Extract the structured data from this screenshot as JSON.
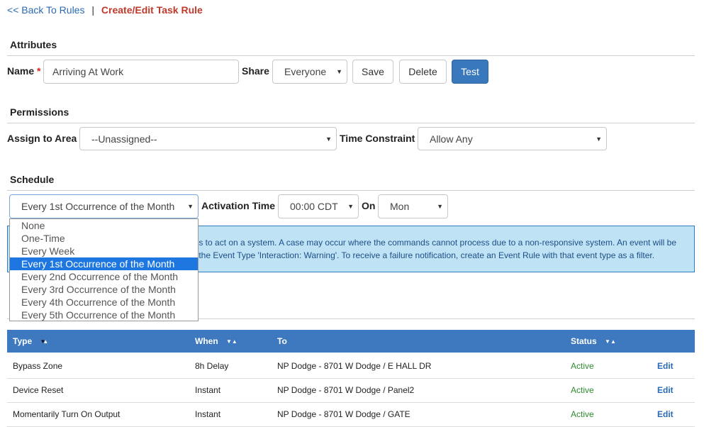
{
  "breadcrumb": {
    "back": "<< Back To Rules",
    "separator": "|",
    "current": "Create/Edit Task Rule"
  },
  "attributes": {
    "title": "Attributes",
    "name_label": "Name",
    "required_mark": "*",
    "name_value": "Arriving At Work",
    "share_label": "Share",
    "share_value": "Everyone",
    "save": "Save",
    "delete": "Delete",
    "test": "Test"
  },
  "permissions": {
    "title": "Permissions",
    "area_label": "Assign to Area",
    "area_value": "--Unassigned--",
    "time_label": "Time Constraint",
    "time_value": "Allow Any"
  },
  "schedule": {
    "title": "Schedule",
    "frequency_value": "Every 1st Occurrence of the Month",
    "activation_label": "Activation Time",
    "activation_value": "00:00 CDT",
    "on_label": "On",
    "on_value": "Mon",
    "options": [
      "None",
      "One-Time",
      "Every Week",
      "Every 1st Occurrence of the Month",
      "Every 2nd Occurrence of the Month",
      "Every 3rd Occurrence of the Month",
      "Every 4th Occurrence of the Month",
      "Every 5th Occurrence of the Month"
    ],
    "selected_index": 3
  },
  "info": {
    "line1": "nds to act on a system. A case may occur where the commands cannot process due to a non-responsive system. An event will be",
    "line2": "th the Event Type 'Interaction: Warning'. To receive a failure notification, create an Event Rule with that event type as a filter."
  },
  "table": {
    "headers": {
      "type": "Type",
      "when": "When",
      "to": "To",
      "status": "Status"
    },
    "rows": [
      {
        "type": "Bypass Zone",
        "when": "8h Delay",
        "to": "NP Dodge - 8701 W Dodge / E HALL DR",
        "status": "Active",
        "action": "Edit"
      },
      {
        "type": "Device Reset",
        "when": "Instant",
        "to": "NP Dodge - 8701 W Dodge / Panel2",
        "status": "Active",
        "action": "Edit"
      },
      {
        "type": "Momentarily Turn On Output",
        "when": "Instant",
        "to": "NP Dodge - 8701 W Dodge / GATE",
        "status": "Active",
        "action": "Edit"
      }
    ]
  },
  "colors": {
    "primary": "#3a78bd",
    "header": "#3e78be",
    "info_bg": "#bfe3f5",
    "active": "#2e8b2e",
    "crumb_current": "#c0392b"
  }
}
